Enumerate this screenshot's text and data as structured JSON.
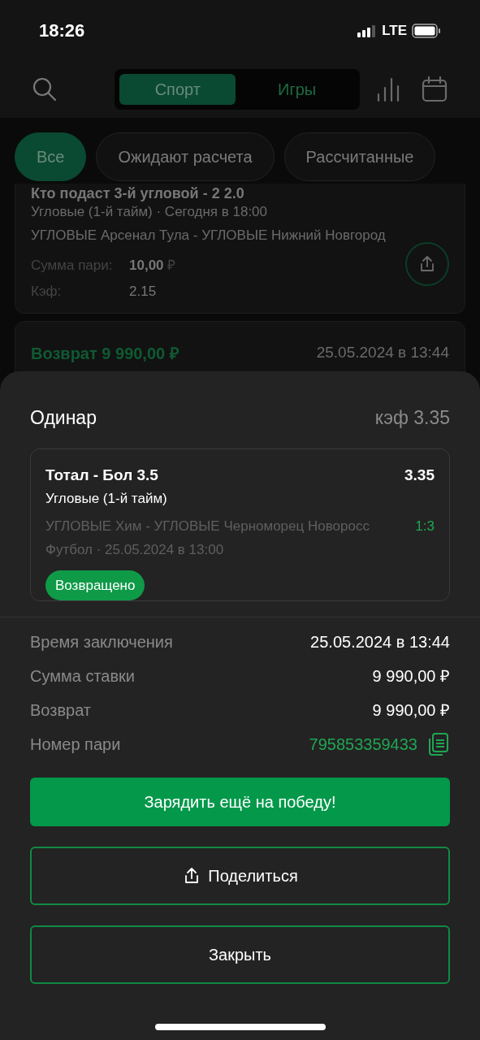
{
  "status_bar": {
    "time": "18:26",
    "network": "LTE"
  },
  "tabs": [
    {
      "label": "Спорт",
      "selected": true
    },
    {
      "label": "Игры",
      "selected": false
    }
  ],
  "filters": [
    {
      "label": "Все",
      "selected": true
    },
    {
      "label": "Ожидают расчета",
      "selected": false
    },
    {
      "label": "Рассчитанные",
      "selected": false
    }
  ],
  "bet_card": {
    "title": "Кто подаст 3-й угловой - 2 2.0",
    "market": "Угловые (1-й тайм) · Сегодня в 18:00",
    "event": "УГЛОВЫЕ Арсенал Тула - УГЛОВЫЕ Нижний Новгород",
    "stake_label": "Сумма пари:",
    "stake_value": "10,00",
    "currency": "₽",
    "odds_label": "Кэф:",
    "odds_value": "2.15"
  },
  "return_card": {
    "label": "Возврат 9 990,00 ₽",
    "date": "25.05.2024 в 13:44"
  },
  "sheet": {
    "title": "Одинар",
    "odds": "кэф 3.35",
    "selection": {
      "title": "Тотал - Бол 3.5",
      "odds": "3.35",
      "market": "Угловые (1-й тайм)",
      "event": "УГЛОВЫЕ Хим  - УГЛОВЫЕ Черноморец Новоросс",
      "score": "1:3",
      "sport_date": "Футбол · 25.05.2024 в 13:00",
      "status": {
        "label": "Возвращено",
        "kind": "returned"
      }
    },
    "details": [
      {
        "label": "Время заключения",
        "value": "25.05.2024 в 13:44",
        "kind": "plain"
      },
      {
        "label": "Сумма ставки",
        "value": "9 990,00 ₽",
        "kind": "plain"
      },
      {
        "label": "Возврат",
        "value": "9 990,00 ₽",
        "kind": "plain"
      },
      {
        "label": "Номер пари",
        "value": "795853359433",
        "kind": "copy"
      }
    ],
    "buttons": [
      {
        "label": "Зарядить ещё на победу!",
        "kind": "primary"
      },
      {
        "label": "Поделиться",
        "kind": "share"
      },
      {
        "label": "Закрыть",
        "kind": "outline"
      }
    ]
  }
}
